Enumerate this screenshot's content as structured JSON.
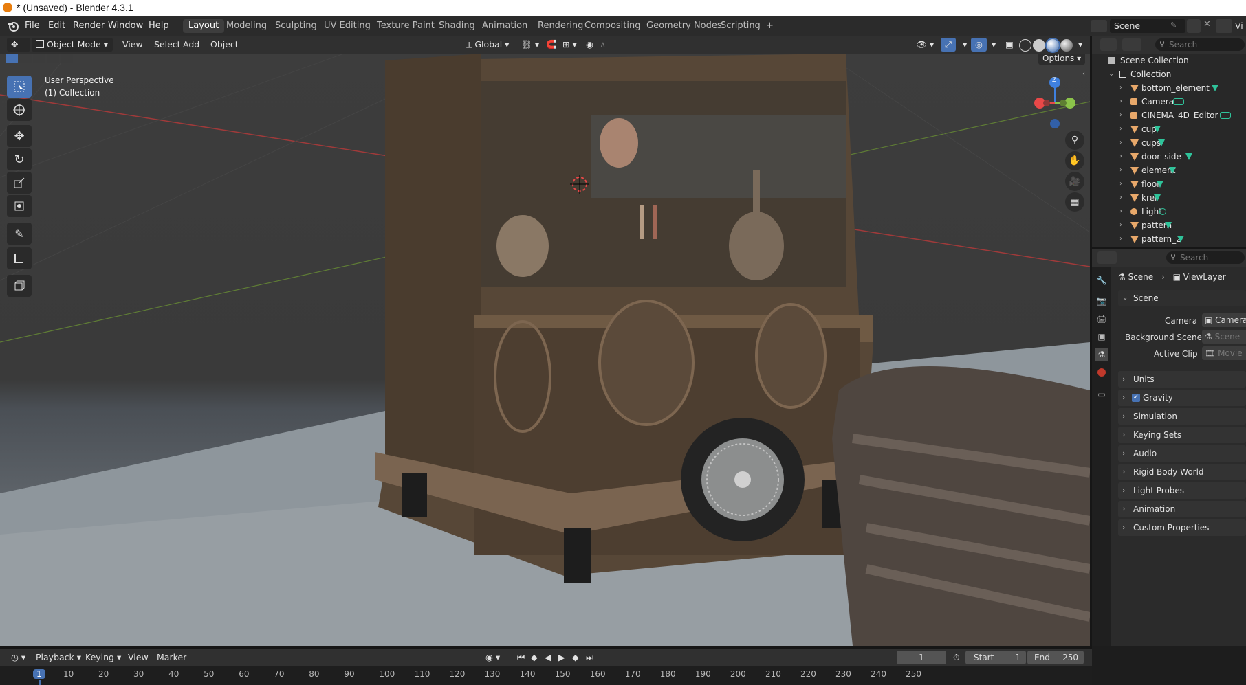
{
  "titlebar": {
    "title": "* (Unsaved) - Blender 4.3.1"
  },
  "menu": [
    "File",
    "Edit",
    "Render",
    "Window",
    "Help"
  ],
  "workspaces": [
    "Layout",
    "Modeling",
    "Sculpting",
    "UV Editing",
    "Texture Paint",
    "Shading",
    "Animation",
    "Rendering",
    "Compositing",
    "Geometry Nodes",
    "Scripting"
  ],
  "workspace_add": "+",
  "scene_selector": {
    "value": "Scene",
    "viewlayer": "Vi"
  },
  "viewport_header": {
    "mode": "Object Mode",
    "menus": [
      "View",
      "Select",
      "Add",
      "Object"
    ],
    "transform_orientation": "Global",
    "options_label": "Options"
  },
  "viewport": {
    "perspective_label": "User Perspective",
    "collection_label": "(1) Collection",
    "gizmo_axis": "Z"
  },
  "outliner": {
    "search_placeholder": "Search",
    "root": "Scene Collection",
    "collection": "Collection",
    "items": [
      {
        "name": "bottom_element",
        "type": "mesh"
      },
      {
        "name": "Camera",
        "type": "camera"
      },
      {
        "name": "CINEMA_4D_Editor",
        "type": "camera"
      },
      {
        "name": "cup",
        "type": "mesh"
      },
      {
        "name": "cups",
        "type": "mesh"
      },
      {
        "name": "door_side",
        "type": "mesh"
      },
      {
        "name": "element",
        "type": "mesh"
      },
      {
        "name": "floor",
        "type": "mesh"
      },
      {
        "name": "krel",
        "type": "mesh"
      },
      {
        "name": "Light",
        "type": "light"
      },
      {
        "name": "pattern",
        "type": "mesh"
      },
      {
        "name": "pattern_2",
        "type": "mesh"
      }
    ]
  },
  "properties": {
    "search_placeholder": "Search",
    "breadcrumb": [
      "Scene",
      "ViewLayer"
    ],
    "section": "Scene",
    "rows": [
      {
        "label": "Camera",
        "value": "Camera"
      },
      {
        "label": "Background Scene",
        "value": "Scene"
      },
      {
        "label": "Active Clip",
        "value": "Movie C"
      }
    ],
    "panels": [
      "Units",
      "Gravity",
      "Simulation",
      "Keying Sets",
      "Audio",
      "Rigid Body World",
      "Light Probes",
      "Animation",
      "Custom Properties"
    ],
    "gravity_checked": true
  },
  "timeline": {
    "menus": [
      "Playback",
      "Keying",
      "View",
      "Marker"
    ],
    "current_frame": "1",
    "start_label": "Start",
    "start_value": "1",
    "end_label": "End",
    "end_value": "250",
    "ticks": [
      "1",
      "10",
      "20",
      "30",
      "40",
      "50",
      "60",
      "70",
      "80",
      "90",
      "100",
      "110",
      "120",
      "130",
      "140",
      "150",
      "160",
      "170",
      "180",
      "190",
      "200",
      "210",
      "220",
      "230",
      "240",
      "250"
    ]
  },
  "colors": {
    "accent": "#4772b3",
    "x_axis": "#e84848",
    "y_axis": "#8bc34a",
    "z_axis": "#3f80df",
    "mesh_icon": "#e8a86a",
    "data_icon": "#2fc39a"
  }
}
